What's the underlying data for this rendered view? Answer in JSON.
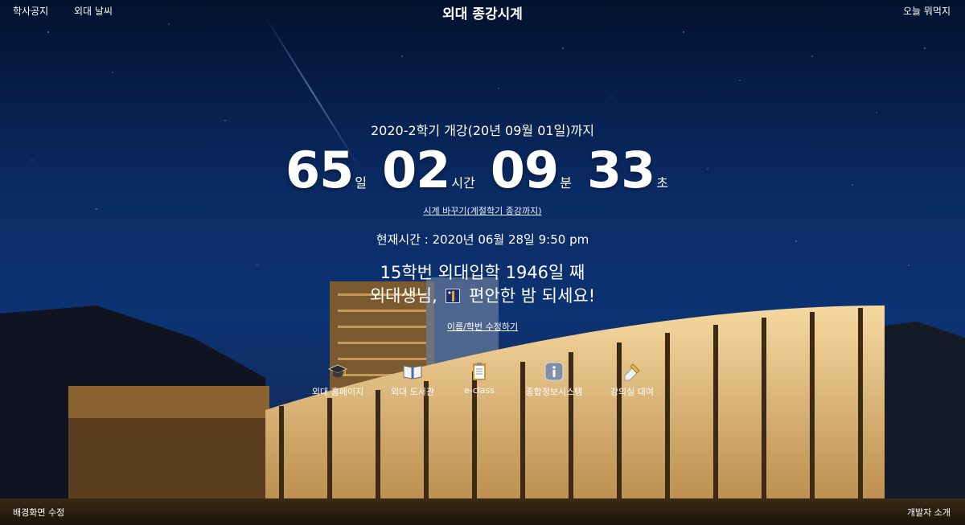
{
  "header": {
    "title": "외대 종강시계",
    "left_links": [
      "학사공지",
      "외대 날씨"
    ],
    "right_link": "오늘 뭐먹지"
  },
  "countdown": {
    "target_label": "2020-2학기 개강(20년 09월 01일)까지",
    "days": "65",
    "days_unit": "일",
    "hours": "02",
    "hours_unit": "시간",
    "minutes": "09",
    "minutes_unit": "분",
    "seconds": "33",
    "seconds_unit": "초",
    "switch_label": "시계 바꾸기(계절학기 종강까지)"
  },
  "now": {
    "text": "현재시간 : 2020년 06월 28일 9:50 pm"
  },
  "greeting": {
    "days_line": "15학번 외대입학 1946일 째",
    "greet_prefix": "외대생님,",
    "greet_suffix": "편안한 밤 되세요!",
    "edit_label": "이름/학번 수정하기"
  },
  "quick_links": [
    {
      "label": "외대 홈페이지",
      "icon": "graduation-cap-icon"
    },
    {
      "label": "외대 도서관",
      "icon": "open-book-icon"
    },
    {
      "label": "e-class",
      "icon": "clipboard-icon"
    },
    {
      "label": "종합정보시스템",
      "icon": "info-icon"
    },
    {
      "label": "강의실 대여",
      "icon": "pencil-note-icon"
    }
  ],
  "footer": {
    "bg_edit": "배경화면 수정",
    "dev_intro": "개발자 소개"
  }
}
